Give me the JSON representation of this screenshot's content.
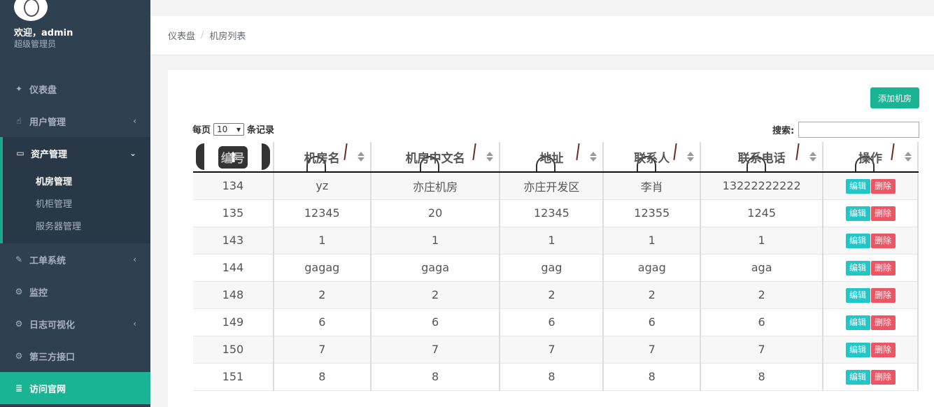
{
  "sidebar": {
    "welcome": "欢迎，admin",
    "role": "超级管理员",
    "items": [
      {
        "label": "仪表盘",
        "icon": "gitlab-icon"
      },
      {
        "label": "用户管理",
        "icon": "hand-icon",
        "chevron": "‹"
      },
      {
        "label": "资产管理",
        "icon": "hdd-icon",
        "chevron": "⌄"
      },
      {
        "label": "工单系统",
        "icon": "edit-icon",
        "chevron": "‹"
      },
      {
        "label": "监控",
        "icon": "cogs-icon"
      },
      {
        "label": "日志可视化",
        "icon": "cogs-icon",
        "chevron": "‹"
      },
      {
        "label": "第三方接口",
        "icon": "cogs-icon"
      },
      {
        "label": "访问官网",
        "icon": "database-icon"
      }
    ],
    "subitems": [
      {
        "label": "机房管理"
      },
      {
        "label": "机柜管理"
      },
      {
        "label": "服务器管理"
      }
    ],
    "accent": "#1ab394"
  },
  "breadcrumb": {
    "home": "仪表盘",
    "separator": "/",
    "current": "机房列表"
  },
  "toolbar": {
    "add_label": "添加机房"
  },
  "length_menu": {
    "prefix": "每页",
    "value": "10",
    "suffix": "条记录"
  },
  "search": {
    "label": "搜索:",
    "value": ""
  },
  "table": {
    "headers": [
      "编号",
      "机房名",
      "机房中文名",
      "地址",
      "联系人",
      "联系电话",
      "操作"
    ],
    "edit_label": "编辑",
    "delete_label": "删除",
    "rows": [
      [
        "134",
        "yz",
        "亦庄机房",
        "亦庄开发区",
        "李肖",
        "13222222222"
      ],
      [
        "135",
        "12345",
        "20",
        "12345",
        "12355",
        "1245"
      ],
      [
        "143",
        "1",
        "1",
        "1",
        "1",
        "1"
      ],
      [
        "144",
        "gagag",
        "gaga",
        "gag",
        "agag",
        "aga"
      ],
      [
        "148",
        "2",
        "2",
        "2",
        "2",
        "2"
      ],
      [
        "149",
        "6",
        "6",
        "6",
        "6",
        "6"
      ],
      [
        "150",
        "7",
        "7",
        "7",
        "7",
        "7"
      ],
      [
        "151",
        "8",
        "8",
        "8",
        "8",
        "8"
      ]
    ]
  }
}
